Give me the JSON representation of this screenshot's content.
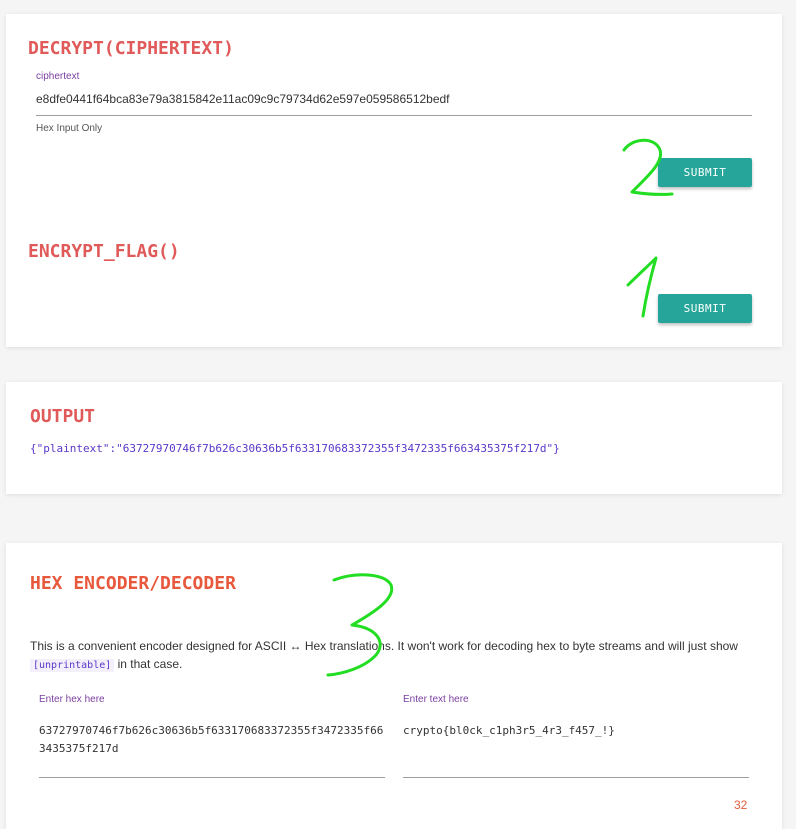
{
  "decrypt": {
    "heading": "DECRYPT(CIPHERTEXT)",
    "field_label": "ciphertext",
    "field_value": "e8dfe0441f64bca83e79a3815842e11ac09c9c79734d62e597e059586512bedf",
    "helper": "Hex Input Only",
    "submit_label": "SUBMIT"
  },
  "encrypt": {
    "heading": "ENCRYPT_FLAG()",
    "submit_label": "SUBMIT"
  },
  "output": {
    "heading": "OUTPUT",
    "text": "{\"plaintext\":\"63727970746f7b626c30636b5f633170683372355f3472335f663435375f217d\"}"
  },
  "hex_tool": {
    "heading": "HEX ENCODER/DECODER",
    "description_before": "This is a convenient encoder designed for ASCII ↔ Hex translations. It won't work for decoding hex to byte streams and will just show",
    "description_code": "[unprintable]",
    "description_after": "in that case.",
    "hex_label": "Enter hex here",
    "hex_value": "63727970746f7b626c30636b5f633170683372355f3472335f663435375f217d",
    "text_label": "Enter text here",
    "text_value": "crypto{bl0ck_c1ph3r5_4r3_f457_!}"
  },
  "annotations": [
    "2",
    "1",
    "3"
  ],
  "page_number": "32",
  "colors": {
    "heading_red": "#e05a5a",
    "heading_orange": "#e8583c",
    "button_teal": "#26a69a",
    "output_purple": "#5a37c8",
    "annotation_green": "#22dd22"
  }
}
